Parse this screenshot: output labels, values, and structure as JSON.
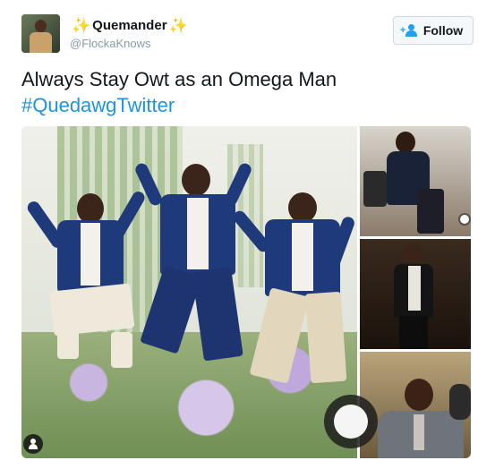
{
  "user": {
    "display_name": "Quemander",
    "handle": "@FlockaKnows",
    "sparkle_left": "✨",
    "sparkle_right": "✨"
  },
  "follow_button": {
    "label": "Follow",
    "icon": "follow-person-plus-icon"
  },
  "tweet": {
    "text": "Always Stay Owt as an Omega Man",
    "hashtag": "#QuedawgTwitter"
  },
  "colors": {
    "link": "#1b95e0",
    "jacket": "#1f3a7a",
    "follow_icon": "#1da1f2"
  }
}
